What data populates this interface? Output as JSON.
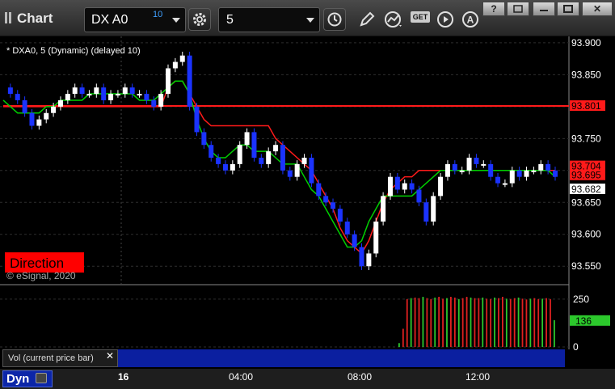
{
  "window": {
    "title": "Chart"
  },
  "toolbar": {
    "symbol": "DX A0",
    "delay_badge": "10",
    "interval": "5",
    "get_label": "GET",
    "icons": [
      "gear-icon",
      "clock-icon",
      "pencil-icon",
      "line-study-icon",
      "get-icon",
      "play-icon",
      "alert-icon"
    ]
  },
  "window_buttons": {
    "help": "?",
    "restore": "",
    "minimize": "",
    "maximize": "",
    "close": "✕"
  },
  "chart": {
    "header": "* DXA0, 5 (Dynamic) (delayed 10)",
    "badge": "Direction",
    "copyright": "© eSignal, 2020",
    "vol_panel_label": "Vol (current price bar)",
    "vol_close": "✕",
    "dyn_label": "Dyn",
    "day_label": "16",
    "x_ticks": [
      "04:00",
      "08:00",
      "12:00"
    ],
    "colors": {
      "background": "#000000",
      "up_bar": "#ffffff",
      "down_bar": "#1b33ff",
      "ma_fast": "#00d000",
      "ma_slow": "#ff1a1a",
      "vol_up": "#2cc82c",
      "vol_down": "#e02020"
    }
  },
  "chart_data": {
    "type": "line",
    "y_axis": {
      "ticks": [
        "93.900",
        "93.850",
        "93.800",
        "93.750",
        "93.700",
        "93.650",
        "93.600",
        "93.550"
      ],
      "ylim": [
        93.53,
        93.91
      ]
    },
    "price_labels": [
      {
        "text": "93.801",
        "color": "#ff1a1a"
      },
      {
        "text": "93.704",
        "color": "#ff1a1a"
      },
      {
        "text": "93.695",
        "color": "#ff1a1a"
      },
      {
        "text": "93.682",
        "color": "#ffffff"
      }
    ],
    "reference_line": {
      "value": 93.801,
      "color": "#ff1a1a"
    },
    "price": [
      93.83,
      93.82,
      93.81,
      93.79,
      93.77,
      93.78,
      93.79,
      93.8,
      93.81,
      93.82,
      93.83,
      93.82,
      93.82,
      93.83,
      93.81,
      93.82,
      93.82,
      93.83,
      93.82,
      93.82,
      93.81,
      93.8,
      93.82,
      93.86,
      93.87,
      93.88,
      93.8,
      93.76,
      93.74,
      93.72,
      93.71,
      93.7,
      93.71,
      93.74,
      93.76,
      93.72,
      93.71,
      93.73,
      93.74,
      93.7,
      93.69,
      93.71,
      93.72,
      93.68,
      93.66,
      93.65,
      93.64,
      93.62,
      93.6,
      93.58,
      93.55,
      93.57,
      93.62,
      93.66,
      93.69,
      93.67,
      93.68,
      93.67,
      93.65,
      93.62,
      93.66,
      93.69,
      93.71,
      93.7,
      93.7,
      93.72,
      93.71,
      93.71,
      93.69,
      93.68,
      93.68,
      93.7,
      93.69,
      93.7,
      93.7,
      93.71,
      93.7,
      93.69
    ],
    "ma_fast": [
      93.81,
      93.8,
      93.79,
      93.79,
      93.79,
      93.79,
      93.8,
      93.8,
      93.81,
      93.81,
      93.81,
      93.81,
      93.82,
      93.82,
      93.82,
      93.82,
      93.82,
      93.82,
      93.82,
      93.81,
      93.81,
      93.81,
      93.82,
      93.83,
      93.84,
      93.84,
      93.82,
      93.78,
      93.75,
      93.73,
      93.72,
      93.72,
      93.73,
      93.74,
      93.74,
      93.73,
      93.73,
      93.73,
      93.72,
      93.71,
      93.71,
      93.71,
      93.69,
      93.67,
      93.66,
      93.64,
      93.62,
      93.6,
      93.58,
      93.58,
      93.59,
      93.62,
      93.64,
      93.66,
      93.66,
      93.66,
      93.66,
      93.66,
      93.67,
      93.68,
      93.69,
      93.7,
      93.7,
      93.7,
      93.7,
      93.7,
      93.7,
      93.7,
      93.7,
      93.7,
      93.7,
      93.7,
      93.7,
      93.7,
      93.7,
      93.7,
      93.7,
      93.69
    ],
    "ma_slow": [
      93.8,
      93.8,
      93.8,
      93.8,
      93.8,
      93.8,
      93.8,
      93.8,
      93.8,
      93.8,
      93.8,
      93.8,
      93.8,
      93.8,
      93.8,
      93.8,
      93.8,
      93.8,
      93.8,
      93.8,
      93.8,
      93.8,
      93.8,
      93.83,
      93.84,
      93.84,
      93.82,
      93.8,
      93.78,
      93.77,
      93.77,
      93.77,
      93.77,
      93.77,
      93.77,
      93.77,
      93.77,
      93.77,
      93.75,
      93.74,
      93.73,
      93.72,
      93.71,
      93.7,
      93.68,
      93.66,
      93.64,
      93.61,
      93.59,
      93.58,
      93.57,
      93.59,
      93.62,
      93.65,
      93.67,
      93.68,
      93.69,
      93.69,
      93.7,
      93.7,
      93.7,
      93.7,
      93.7,
      93.7,
      93.7,
      93.7,
      93.7,
      93.7,
      93.7,
      93.7,
      93.7,
      93.7,
      93.7,
      93.7,
      93.7,
      93.7,
      93.7,
      93.7
    ],
    "volume": {
      "y_ticks": [
        "250",
        "0"
      ],
      "current_label": "136",
      "ylim": [
        0,
        300
      ],
      "values": [
        20,
        95,
        250,
        255,
        258,
        255,
        262,
        255,
        250,
        258,
        262,
        252,
        255,
        262,
        258,
        250,
        255,
        262,
        258,
        255,
        255,
        258,
        252,
        250,
        258,
        255,
        262,
        252,
        250,
        255,
        258,
        252,
        248,
        252,
        255,
        250,
        252,
        255,
        250,
        140
      ]
    }
  }
}
